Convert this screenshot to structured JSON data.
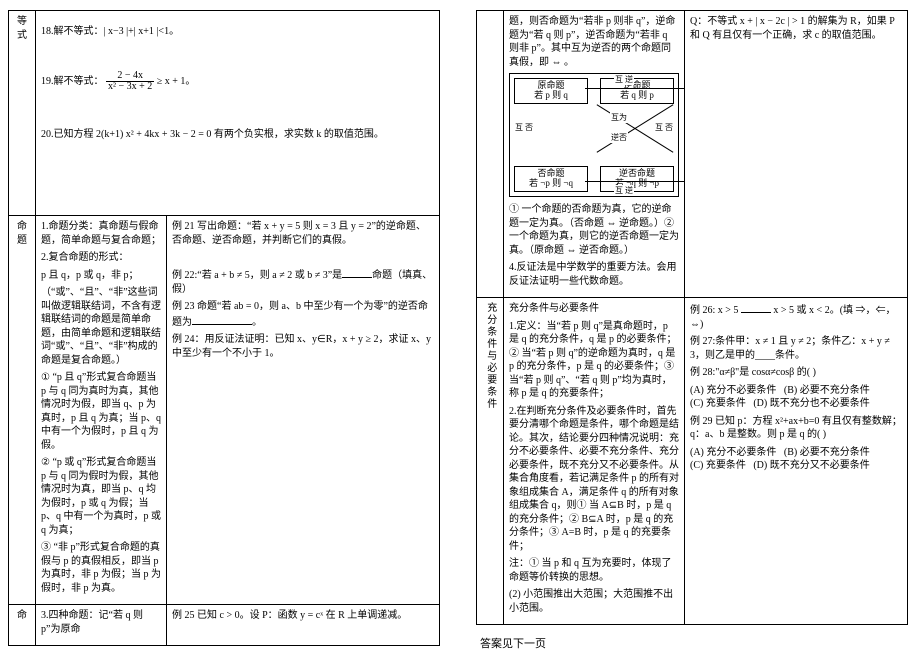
{
  "left": {
    "row1_side": "等式",
    "row1_body": {
      "p18": "18.解不等式：| x−3 |+| x+1 |<1。",
      "p19_pre": "19.解不等式：",
      "p19_frac_num": "2 − 4x",
      "p19_frac_den": "x² − 3x + 2",
      "p19_post": " ≥ x + 1。",
      "p20": "20.已知方程 2(k+1) x² + 4kx + 3k − 2 = 0 有两个负实根，求实数 k 的取值范围。"
    },
    "row2_side": "命题",
    "row2_narrow": {
      "t1": "1.命题分类：真命题与假命题，简单命题与复合命题；",
      "t2": "2.复合命题的形式：",
      "t3": "p 且 q，p 或 q，非 p；",
      "t4": "（“或”、“且”、“非”这些词叫做逻辑联结词，不含有逻辑联结词的命题是简单命题，由简单命题和逻辑联结词“或”、“且”、“非”构成的命题是复合命题。）",
      "t5": "① “p 且 q”形式复合命题当 p 与 q 同为真时为真，其他情况时为假，即当 q、p 为真时，p 且 q 为真；当 p、q 中有一个为假时，p 且 q 为假。",
      "t6": "② “p 或 q”形式复合命题当 p 与 q 同为假时为假，其他情况时为真，即当 p、q 均为假时，p 或 q 为假；当 p、q 中有一个为真时，p 或 q 为真；",
      "t7": "③ “非 p”形式复合命题的真假与 p 的真假相反，即当 p 为真时，非 p 为假；当 p 为假时，非 p 为真。"
    },
    "row2_main": {
      "e21": "例 21 写出命题：“若 x + y = 5 则 x = 3 且 y = 2”的逆命题、否命题、逆否命题，并判断它们的真假。",
      "e22_pre": "例 22:“若 a + b ≠ 5，则 a ≠ 2 或 b ≠ 3”是",
      "e22_post": "命题（填真、假）",
      "e23_pre": "例 23 命题“若 ab = 0，则 a、b 中至少有一个为零”的逆否命题为",
      "e23_post": "。",
      "e24": "例 24：用反证法证明：已知 x、y∈R，x + y ≥ 2，求证 x、y 中至少有一个不小于 1。"
    },
    "row3_side": "命",
    "row3_narrow": "3.四种命题：记“若 q 则 p”为原命",
    "row3_main": "例 25 已知 c > 0。设 P：函数 y = cˣ 在 R 上单调递减。"
  },
  "right": {
    "row1_main": {
      "t1": "题，则否命题为“若非 p 则非 q”，逆命题为“若 q 则 p”，逆否命题为“若非 q 则非 p”。其中互为逆否的两个命题同真假，即 ⇔ 。",
      "t2": "① 一个命题的否命题为真，它的逆命题一定为真。（否命题 ⇔ 逆命题。）② 一个命题为真，则它的逆否命题一定为真。（原命题 ⇔ 逆否命题。）",
      "t3": "4.反证法是中学数学的重要方法。会用反证法证明一些代数命题。"
    },
    "row1_right": {
      "t1": "Q：不等式 x + | x − 2c | > 1 的解集为 R，如果 P 和 Q 有且仅有一个正确，求 c 的取值范围。"
    },
    "diagram": {
      "title": "",
      "b1a": "原命题",
      "b1b": "若 p 则 q",
      "b2a": "逆命题",
      "b2b": "若 q 则 p",
      "b3a": "否命题",
      "b3b": "若 ¬p 则 ¬q",
      "b4a": "逆否命题",
      "b4b": "若 ¬q 则 ¬p",
      "l_top": "互 逆",
      "l_bot": "互 逆",
      "l_left": "互 否",
      "l_right": "互 否",
      "l_c1": "互为",
      "l_c2": "逆否"
    },
    "row2_side": "充分条件与必要条件",
    "row2_narrow": {
      "h": "充分条件与必要条件",
      "t1": "1.定义：当“若 p 则 q”是真命题时，p 是 q 的充分条件，q 是 p 的必要条件；② 当“若 p 则 q”的逆命题为真时，q 是 p 的充分条件，p 是 q 的必要条件；③ 当“若 p 则 q”、“若 q 则 p”均为真时，称 p 是 q 的充要条件；",
      "t2": "2.在判断充分条件及必要条件时，首先要分清哪个命题是条件，哪个命题是结论。其次，结论要分四种情况说明：充分不必要条件、必要不充分条件、充分必要条件，既不充分又不必要条件。从集合角度看，若记满足条件 p 的所有对象组成集合 A，满足条件 q 的所有对象组成集合 q，则① 当 A⊆B 时，p 是 q 的充分条件；② B⊆A 时，p 是 q 的充分条件；③ A=B 时，p 是 q 的充要条件；",
      "t3": "注：① 当 p 和 q 互为充要时，体现了命题等价转换的思想。",
      "t4": "(2) 小范围推出大范围；大范围推不出小范围。"
    },
    "row2_right": {
      "e26_pre": "例 26: x > 5 ",
      "e26_post": " x > 5 或 x < 2。(填 ⇒，⇐，⇔)",
      "e27": "例 27:条件甲：x ≠ 1 且 y ≠ 2；条件乙：x + y ≠ 3，则乙是甲的____条件。",
      "e28": "例 28:\"α≠β\"是 cosα≠cosβ 的(   )",
      "e28A": "(A) 充分不必要条件",
      "e28B": "(B) 必要不充分条件",
      "e28C": "(C) 充要条件",
      "e28D": "(D) 既不充分也不必要条件",
      "e29": "例 29 已知 p：方程 x²+ax+b=0 有且仅有整数解；q：a、b 是整数。则 p 是 q 的(   )",
      "e29A": "(A) 充分不必要条件",
      "e29B": "(B) 必要不充分条件",
      "e29C": "(C) 充要条件",
      "e29D": "(D) 既不充分又不必要条件"
    }
  },
  "footer": "答案见下一页"
}
